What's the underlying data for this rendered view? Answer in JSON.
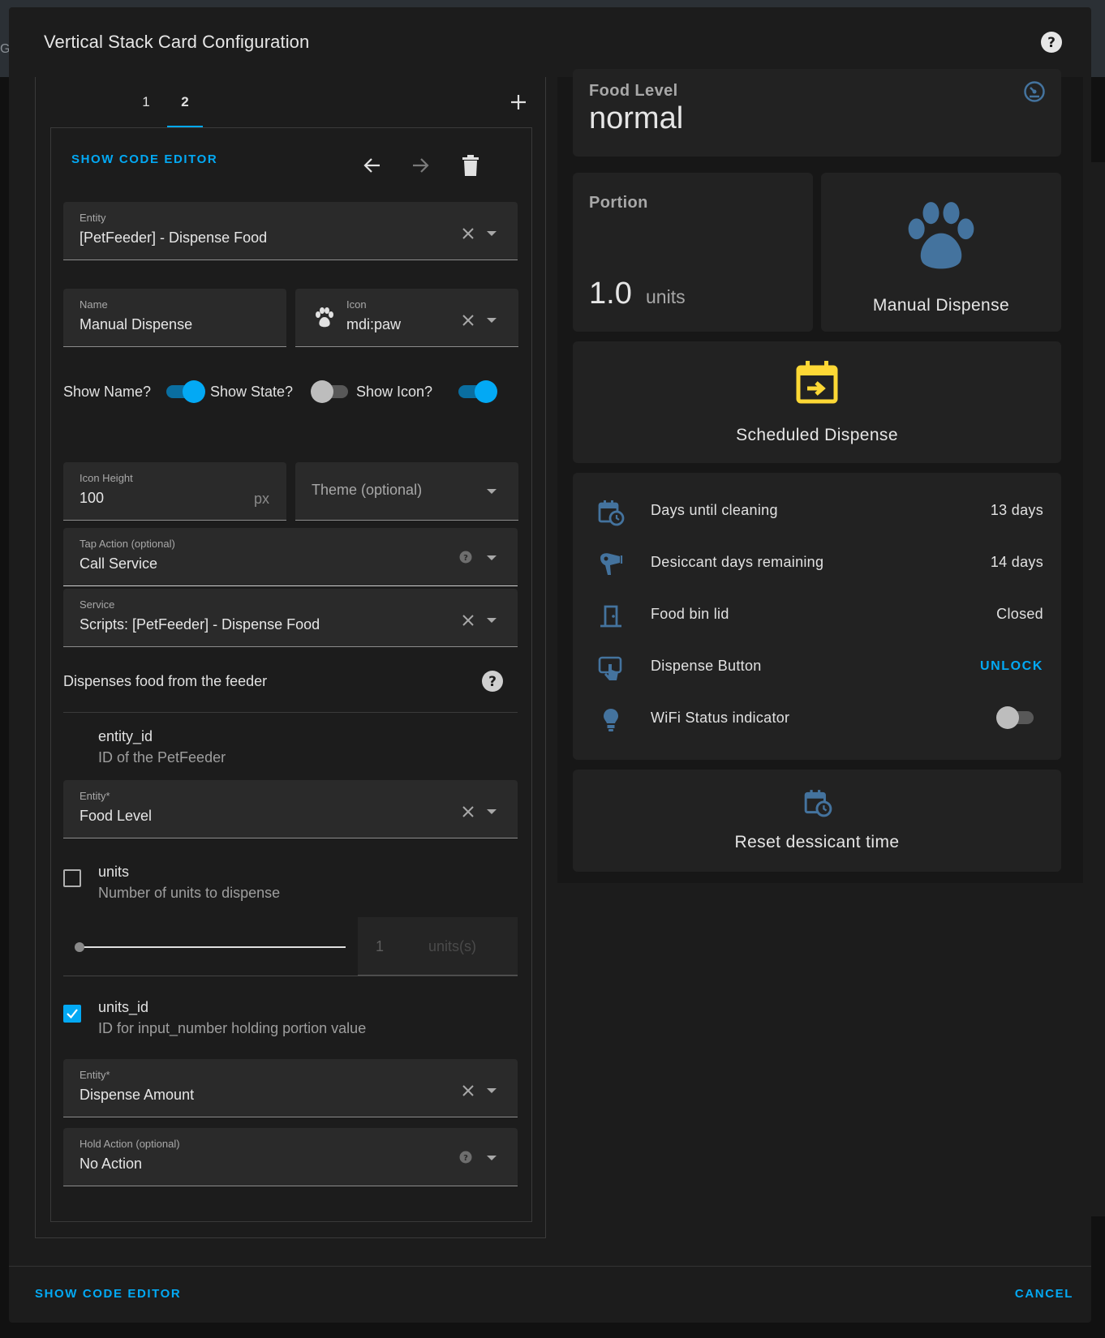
{
  "dialog": {
    "title": "Vertical Stack Card Configuration",
    "background_letter": "GE"
  },
  "tabs": [
    "1",
    "2"
  ],
  "editor": {
    "show_code_editor": "SHOW CODE EDITOR",
    "entity": {
      "label": "Entity",
      "value": "[PetFeeder] - Dispense Food"
    },
    "name": {
      "label": "Name",
      "value": "Manual Dispense"
    },
    "icon": {
      "label": "Icon",
      "value": "mdi:paw"
    },
    "toggles": {
      "show_name": "Show Name?",
      "show_state": "Show State?",
      "show_icon": "Show Icon?",
      "show_name_on": true,
      "show_state_on": false,
      "show_icon_on": true
    },
    "icon_height": {
      "label": "Icon Height",
      "value": "100",
      "suffix": "px"
    },
    "theme": {
      "placeholder": "Theme (optional)"
    },
    "tap_action": {
      "label": "Tap Action (optional)",
      "value": "Call Service"
    },
    "service": {
      "label": "Service",
      "value": "Scripts: [PetFeeder] - Dispense Food"
    },
    "service_description": "Dispenses food from the feeder",
    "param_entity_id": {
      "name": "entity_id",
      "description": "ID of the PetFeeder"
    },
    "entity_required": {
      "label": "Entity*",
      "value": "Food Level"
    },
    "param_units": {
      "name": "units",
      "description": "Number of units to dispense",
      "checked": false
    },
    "slider": {
      "value": "1",
      "unit": "units(s)"
    },
    "param_units_id": {
      "name": "units_id",
      "description": "ID for input_number holding portion value",
      "checked": true
    },
    "entity_required_2": {
      "label": "Entity*",
      "value": "Dispense Amount"
    },
    "hold_action": {
      "label": "Hold Action (optional)",
      "value": "No Action"
    }
  },
  "preview": {
    "food_level": {
      "name": "Food Level",
      "state": "normal"
    },
    "portion": {
      "name": "Portion",
      "value": "1.0",
      "unit": "units"
    },
    "manual_dispense": "Manual Dispense",
    "scheduled_dispense": "Scheduled Dispense",
    "entities": [
      {
        "name": "Days until cleaning",
        "value": "13 days",
        "icon": "calendar-clock-icon"
      },
      {
        "name": "Desiccant days remaining",
        "value": "14 days",
        "icon": "hair-dryer-icon"
      },
      {
        "name": "Food bin lid",
        "value": "Closed",
        "icon": "door-icon"
      },
      {
        "name": "Dispense Button",
        "value": "UNLOCK",
        "icon": "gesture-tap-icon"
      },
      {
        "name": "WiFi Status indicator",
        "value": "",
        "icon": "lightbulb-icon"
      }
    ],
    "reset": "Reset dessicant time",
    "accent_blue": "#44739e",
    "accent_yellow": "#fdd835"
  },
  "footer": {
    "show_code_editor": "SHOW CODE EDITOR",
    "cancel": "CANCEL"
  }
}
